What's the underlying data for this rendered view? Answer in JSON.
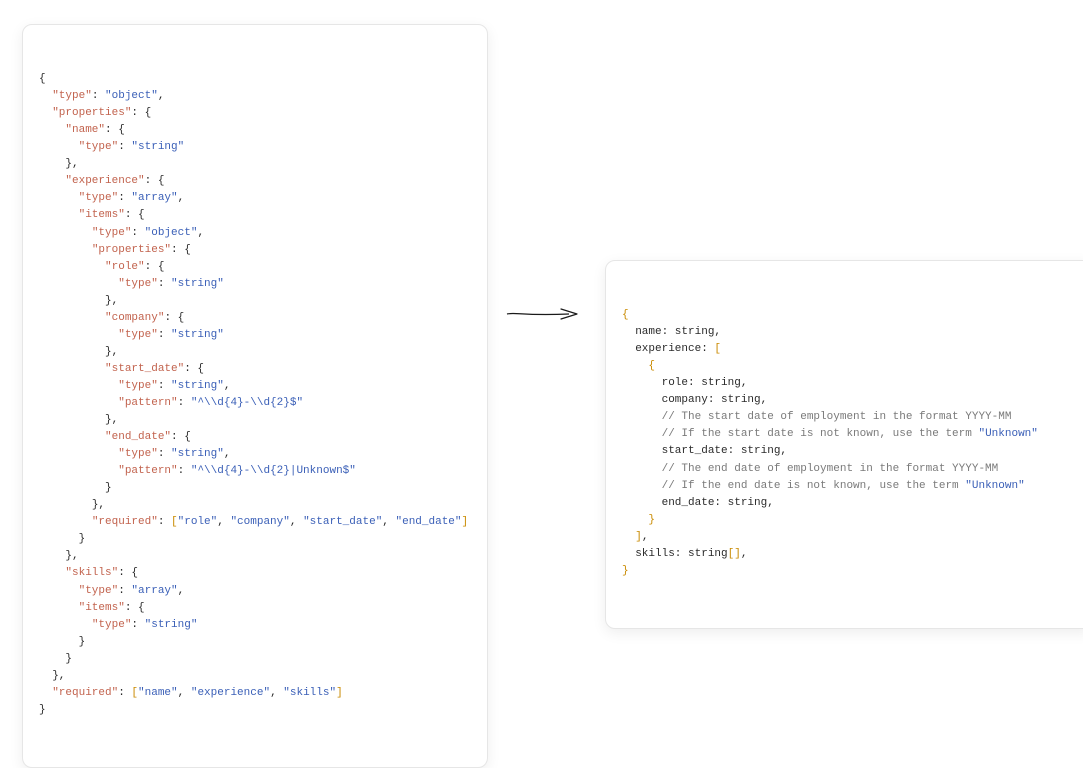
{
  "left_schema": {
    "lines": [
      {
        "indent": 0,
        "tokens": [
          {
            "t": "p",
            "v": "{"
          }
        ]
      },
      {
        "indent": 1,
        "tokens": [
          {
            "t": "k",
            "v": "\"type\""
          },
          {
            "t": "p",
            "v": ": "
          },
          {
            "t": "s",
            "v": "\"object\""
          },
          {
            "t": "p",
            "v": ","
          }
        ]
      },
      {
        "indent": 1,
        "tokens": [
          {
            "t": "k",
            "v": "\"properties\""
          },
          {
            "t": "p",
            "v": ": {"
          }
        ]
      },
      {
        "indent": 2,
        "tokens": [
          {
            "t": "k",
            "v": "\"name\""
          },
          {
            "t": "p",
            "v": ": {"
          }
        ]
      },
      {
        "indent": 3,
        "tokens": [
          {
            "t": "k",
            "v": "\"type\""
          },
          {
            "t": "p",
            "v": ": "
          },
          {
            "t": "s",
            "v": "\"string\""
          }
        ]
      },
      {
        "indent": 2,
        "tokens": [
          {
            "t": "p",
            "v": "},"
          }
        ]
      },
      {
        "indent": 2,
        "tokens": [
          {
            "t": "k",
            "v": "\"experience\""
          },
          {
            "t": "p",
            "v": ": {"
          }
        ]
      },
      {
        "indent": 3,
        "tokens": [
          {
            "t": "k",
            "v": "\"type\""
          },
          {
            "t": "p",
            "v": ": "
          },
          {
            "t": "s",
            "v": "\"array\""
          },
          {
            "t": "p",
            "v": ","
          }
        ]
      },
      {
        "indent": 3,
        "tokens": [
          {
            "t": "k",
            "v": "\"items\""
          },
          {
            "t": "p",
            "v": ": {"
          }
        ]
      },
      {
        "indent": 4,
        "tokens": [
          {
            "t": "k",
            "v": "\"type\""
          },
          {
            "t": "p",
            "v": ": "
          },
          {
            "t": "s",
            "v": "\"object\""
          },
          {
            "t": "p",
            "v": ","
          }
        ]
      },
      {
        "indent": 4,
        "tokens": [
          {
            "t": "k",
            "v": "\"properties\""
          },
          {
            "t": "p",
            "v": ": {"
          }
        ]
      },
      {
        "indent": 5,
        "tokens": [
          {
            "t": "k",
            "v": "\"role\""
          },
          {
            "t": "p",
            "v": ": {"
          }
        ]
      },
      {
        "indent": 6,
        "tokens": [
          {
            "t": "k",
            "v": "\"type\""
          },
          {
            "t": "p",
            "v": ": "
          },
          {
            "t": "s",
            "v": "\"string\""
          }
        ]
      },
      {
        "indent": 5,
        "tokens": [
          {
            "t": "p",
            "v": "},"
          }
        ]
      },
      {
        "indent": 5,
        "tokens": [
          {
            "t": "k",
            "v": "\"company\""
          },
          {
            "t": "p",
            "v": ": {"
          }
        ]
      },
      {
        "indent": 6,
        "tokens": [
          {
            "t": "k",
            "v": "\"type\""
          },
          {
            "t": "p",
            "v": ": "
          },
          {
            "t": "s",
            "v": "\"string\""
          }
        ]
      },
      {
        "indent": 5,
        "tokens": [
          {
            "t": "p",
            "v": "},"
          }
        ]
      },
      {
        "indent": 5,
        "tokens": [
          {
            "t": "k",
            "v": "\"start_date\""
          },
          {
            "t": "p",
            "v": ": {"
          }
        ]
      },
      {
        "indent": 6,
        "tokens": [
          {
            "t": "k",
            "v": "\"type\""
          },
          {
            "t": "p",
            "v": ": "
          },
          {
            "t": "s",
            "v": "\"string\""
          },
          {
            "t": "p",
            "v": ","
          }
        ]
      },
      {
        "indent": 6,
        "tokens": [
          {
            "t": "k",
            "v": "\"pattern\""
          },
          {
            "t": "p",
            "v": ": "
          },
          {
            "t": "s",
            "v": "\"^\\\\d{4}-\\\\d{2}$\""
          }
        ]
      },
      {
        "indent": 5,
        "tokens": [
          {
            "t": "p",
            "v": "},"
          }
        ]
      },
      {
        "indent": 5,
        "tokens": [
          {
            "t": "k",
            "v": "\"end_date\""
          },
          {
            "t": "p",
            "v": ": {"
          }
        ]
      },
      {
        "indent": 6,
        "tokens": [
          {
            "t": "k",
            "v": "\"type\""
          },
          {
            "t": "p",
            "v": ": "
          },
          {
            "t": "s",
            "v": "\"string\""
          },
          {
            "t": "p",
            "v": ","
          }
        ]
      },
      {
        "indent": 6,
        "tokens": [
          {
            "t": "k",
            "v": "\"pattern\""
          },
          {
            "t": "p",
            "v": ": "
          },
          {
            "t": "s",
            "v": "\"^\\\\d{4}-\\\\d{2}|Unknown$\""
          }
        ]
      },
      {
        "indent": 5,
        "tokens": [
          {
            "t": "p",
            "v": "}"
          }
        ]
      },
      {
        "indent": 4,
        "tokens": [
          {
            "t": "p",
            "v": "},"
          }
        ]
      },
      {
        "indent": 4,
        "tokens": [
          {
            "t": "k",
            "v": "\"required\""
          },
          {
            "t": "p",
            "v": ": "
          },
          {
            "t": "b",
            "v": "["
          },
          {
            "t": "s",
            "v": "\"role\""
          },
          {
            "t": "p",
            "v": ", "
          },
          {
            "t": "s",
            "v": "\"company\""
          },
          {
            "t": "p",
            "v": ", "
          },
          {
            "t": "s",
            "v": "\"start_date\""
          },
          {
            "t": "p",
            "v": ", "
          },
          {
            "t": "s",
            "v": "\"end_date\""
          },
          {
            "t": "b",
            "v": "]"
          }
        ]
      },
      {
        "indent": 3,
        "tokens": [
          {
            "t": "p",
            "v": "}"
          }
        ]
      },
      {
        "indent": 2,
        "tokens": [
          {
            "t": "p",
            "v": "},"
          }
        ]
      },
      {
        "indent": 2,
        "tokens": [
          {
            "t": "k",
            "v": "\"skills\""
          },
          {
            "t": "p",
            "v": ": {"
          }
        ]
      },
      {
        "indent": 3,
        "tokens": [
          {
            "t": "k",
            "v": "\"type\""
          },
          {
            "t": "p",
            "v": ": "
          },
          {
            "t": "s",
            "v": "\"array\""
          },
          {
            "t": "p",
            "v": ","
          }
        ]
      },
      {
        "indent": 3,
        "tokens": [
          {
            "t": "k",
            "v": "\"items\""
          },
          {
            "t": "p",
            "v": ": {"
          }
        ]
      },
      {
        "indent": 4,
        "tokens": [
          {
            "t": "k",
            "v": "\"type\""
          },
          {
            "t": "p",
            "v": ": "
          },
          {
            "t": "s",
            "v": "\"string\""
          }
        ]
      },
      {
        "indent": 3,
        "tokens": [
          {
            "t": "p",
            "v": "}"
          }
        ]
      },
      {
        "indent": 2,
        "tokens": [
          {
            "t": "p",
            "v": "}"
          }
        ]
      },
      {
        "indent": 1,
        "tokens": [
          {
            "t": "p",
            "v": "},"
          }
        ]
      },
      {
        "indent": 1,
        "tokens": [
          {
            "t": "k",
            "v": "\"required\""
          },
          {
            "t": "p",
            "v": ": "
          },
          {
            "t": "b",
            "v": "["
          },
          {
            "t": "s",
            "v": "\"name\""
          },
          {
            "t": "p",
            "v": ", "
          },
          {
            "t": "s",
            "v": "\"experience\""
          },
          {
            "t": "p",
            "v": ", "
          },
          {
            "t": "s",
            "v": "\"skills\""
          },
          {
            "t": "b",
            "v": "]"
          }
        ]
      },
      {
        "indent": 0,
        "tokens": [
          {
            "t": "p",
            "v": "}"
          }
        ]
      }
    ]
  },
  "right_schema": {
    "lines": [
      {
        "indent": 0,
        "tokens": [
          {
            "t": "b",
            "v": "{"
          }
        ]
      },
      {
        "indent": 1,
        "tokens": [
          {
            "t": "id",
            "v": "name: string,"
          }
        ]
      },
      {
        "indent": 1,
        "tokens": [
          {
            "t": "id",
            "v": "experience: "
          },
          {
            "t": "b",
            "v": "["
          }
        ]
      },
      {
        "indent": 2,
        "tokens": [
          {
            "t": "b",
            "v": "{"
          }
        ]
      },
      {
        "indent": 3,
        "tokens": [
          {
            "t": "id",
            "v": "role: string,"
          }
        ]
      },
      {
        "indent": 3,
        "tokens": [
          {
            "t": "id",
            "v": "company: string,"
          }
        ]
      },
      {
        "indent": 3,
        "tokens": [
          {
            "t": "cm",
            "v": "// The start date of employment in the format YYYY-MM"
          }
        ]
      },
      {
        "indent": 3,
        "tokens": [
          {
            "t": "cm",
            "v": "// If the start date is not known, use the term "
          },
          {
            "t": "s",
            "v": "\"Unknown\""
          }
        ]
      },
      {
        "indent": 3,
        "tokens": [
          {
            "t": "id",
            "v": "start_date: string,"
          }
        ]
      },
      {
        "indent": 3,
        "tokens": [
          {
            "t": "cm",
            "v": "// The end date of employment in the format YYYY-MM"
          }
        ]
      },
      {
        "indent": 3,
        "tokens": [
          {
            "t": "cm",
            "v": "// If the end date is not known, use the term "
          },
          {
            "t": "s",
            "v": "\"Unknown\""
          }
        ]
      },
      {
        "indent": 3,
        "tokens": [
          {
            "t": "id",
            "v": "end_date: string,"
          }
        ]
      },
      {
        "indent": 2,
        "tokens": [
          {
            "t": "b",
            "v": "}"
          }
        ]
      },
      {
        "indent": 1,
        "tokens": [
          {
            "t": "b",
            "v": "]"
          },
          {
            "t": "id",
            "v": ","
          }
        ]
      },
      {
        "indent": 1,
        "tokens": [
          {
            "t": "id",
            "v": "skills: string"
          },
          {
            "t": "b",
            "v": "[]"
          },
          {
            "t": "id",
            "v": ","
          }
        ]
      },
      {
        "indent": 0,
        "tokens": [
          {
            "t": "b",
            "v": "}"
          }
        ]
      }
    ]
  },
  "indent_unit": "  "
}
